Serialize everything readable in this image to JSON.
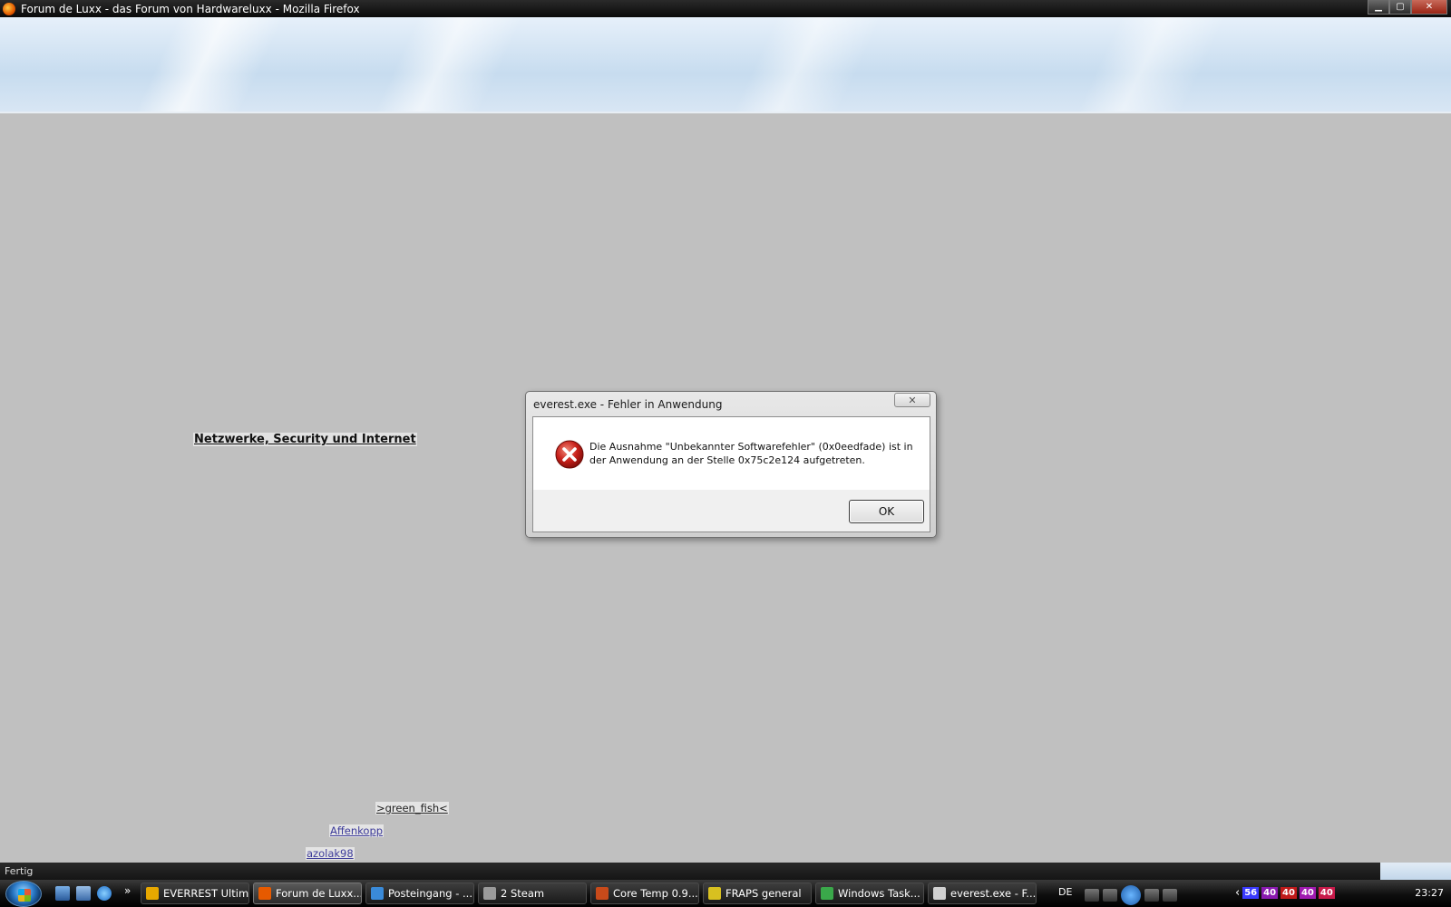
{
  "window": {
    "title": "Forum de Luxx - das Forum von Hardwareluxx - Mozilla Firefox"
  },
  "page": {
    "heading": "Netzwerke, Security und Internet",
    "users": [
      ">green_fish<",
      "Affenkopp",
      "azolak98"
    ]
  },
  "statusbar": {
    "text": "Fertig"
  },
  "dialog": {
    "title": "everest.exe - Fehler in Anwendung",
    "close": "✕",
    "message": "Die Ausnahme \"Unbekannter Softwarefehler\" (0x0eedfade) ist in der Anwendung an der Stelle 0x75c2e124 aufgetreten.",
    "ok_label": "OK",
    "icon": "error-icon"
  },
  "taskbar": {
    "more": "»",
    "tasks": [
      {
        "label": "EVERREST Ultim...",
        "icon_color": "#e8a800"
      },
      {
        "label": "Forum de Luxx...",
        "icon_color": "#e65a00"
      },
      {
        "label": "Posteingang - ...",
        "icon_color": "#3a8ad8"
      },
      {
        "label": "2 Steam",
        "icon_color": "#9a9a9a"
      },
      {
        "label": "Core Temp 0.9....",
        "icon_color": "#c84a1a"
      },
      {
        "label": "FRAPS general",
        "icon_color": "#d8c020"
      },
      {
        "label": "Windows Task...",
        "icon_color": "#3aa84a"
      },
      {
        "label": "everest.exe - F...",
        "icon_color": "#d0d0d0"
      }
    ],
    "language": "DE",
    "tray_temps": [
      {
        "value": "56",
        "color": "#3a3aff"
      },
      {
        "value": "40",
        "color": "#8a1ab0"
      },
      {
        "value": "40",
        "color": "#c01a1a"
      },
      {
        "value": "40",
        "color": "#a01ab0"
      },
      {
        "value": "40",
        "color": "#c81a4a"
      }
    ],
    "clock": "23:27"
  },
  "colors": {
    "page_background": "#c0c0c0",
    "link": "#3d3b9a",
    "error_red": "#c8201a"
  }
}
